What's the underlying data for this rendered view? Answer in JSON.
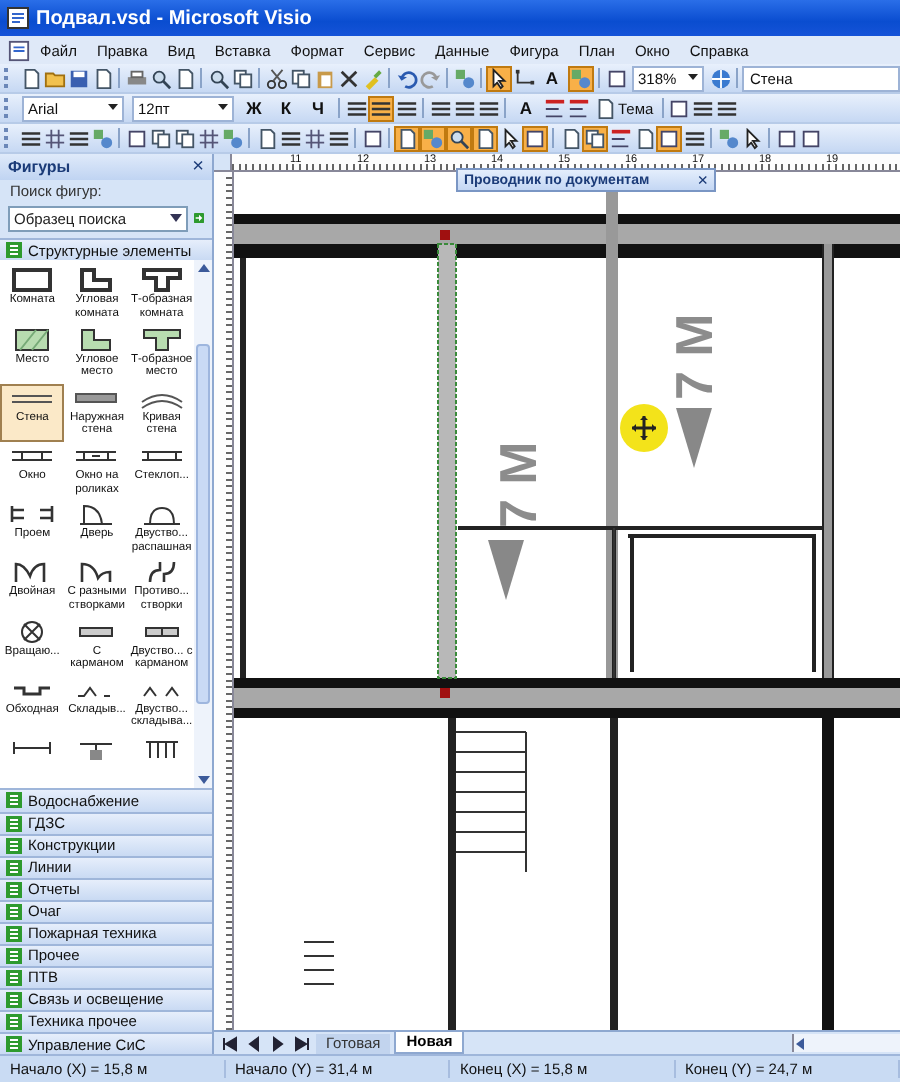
{
  "window": {
    "title": "Подвал.vsd - Microsoft Visio"
  },
  "menu": [
    "Файл",
    "Правка",
    "Вид",
    "Вставка",
    "Формат",
    "Сервис",
    "Данные",
    "Фигура",
    "План",
    "Окно",
    "Справка"
  ],
  "toolbars": [
    {
      "items": [
        {
          "kind": "icon",
          "pressed": false
        },
        {
          "kind": "icon",
          "pressed": false
        },
        {
          "kind": "icon",
          "pressed": false
        },
        {
          "kind": "icon",
          "pressed": false
        },
        {
          "kind": "separator"
        },
        {
          "kind": "icon",
          "pressed": false
        },
        {
          "kind": "icon",
          "pressed": false
        },
        {
          "kind": "icon",
          "pressed": false
        },
        {
          "kind": "separator"
        },
        {
          "kind": "icon",
          "pressed": false
        },
        {
          "kind": "icon",
          "pressed": false
        },
        {
          "kind": "separator"
        },
        {
          "kind": "icon",
          "pressed": false
        },
        {
          "kind": "icon",
          "pressed": false
        },
        {
          "kind": "icon",
          "pressed": false
        },
        {
          "kind": "icon",
          "pressed": false
        },
        {
          "kind": "icon",
          "pressed": false
        },
        {
          "kind": "separator"
        },
        {
          "kind": "icon",
          "pressed": false
        },
        {
          "kind": "icon",
          "pressed": false
        },
        {
          "kind": "separator"
        },
        {
          "kind": "icon",
          "pressed": false
        },
        {
          "kind": "separator"
        },
        {
          "kind": "icon",
          "pressed": true
        },
        {
          "kind": "icon",
          "pressed": false
        },
        {
          "kind": "text",
          "label": "A",
          "pressed": false
        },
        {
          "kind": "icon",
          "pressed": true
        },
        {
          "kind": "separator"
        },
        {
          "kind": "icon",
          "pressed": false
        },
        {
          "kind": "dropdown",
          "value": "318%"
        },
        {
          "kind": "icon",
          "pressed": false
        },
        {
          "kind": "separator"
        },
        {
          "kind": "field",
          "value": "Стена"
        }
      ]
    },
    {
      "items": [
        {
          "kind": "dropdown",
          "value": "Arial"
        },
        {
          "kind": "dropdown",
          "value": "12пт"
        },
        {
          "kind": "text",
          "label": "Ж",
          "pressed": false
        },
        {
          "kind": "text",
          "label": "К",
          "pressed": false
        },
        {
          "kind": "text",
          "label": "Ч",
          "pressed": false
        },
        {
          "kind": "separator"
        },
        {
          "kind": "icon",
          "pressed": false
        },
        {
          "kind": "icon",
          "pressed": true
        },
        {
          "kind": "icon",
          "pressed": false
        },
        {
          "kind": "separator"
        },
        {
          "kind": "icon",
          "pressed": false
        },
        {
          "kind": "icon",
          "pressed": false
        },
        {
          "kind": "icon",
          "pressed": false
        },
        {
          "kind": "separator"
        },
        {
          "kind": "text",
          "label": "A",
          "pressed": false
        },
        {
          "kind": "icon",
          "pressed": false
        },
        {
          "kind": "icon",
          "pressed": false
        },
        {
          "kind": "icon-text",
          "label": "Тема",
          "pressed": false
        },
        {
          "kind": "separator"
        },
        {
          "kind": "icon",
          "pressed": false
        },
        {
          "kind": "icon",
          "pressed": false
        },
        {
          "kind": "icon",
          "pressed": false
        }
      ]
    },
    {
      "items": [
        {
          "kind": "icon",
          "pressed": false
        },
        {
          "kind": "icon",
          "pressed": false
        },
        {
          "kind": "icon",
          "pressed": false
        },
        {
          "kind": "icon",
          "pressed": false
        },
        {
          "kind": "separator"
        },
        {
          "kind": "icon",
          "pressed": false
        },
        {
          "kind": "icon",
          "pressed": false
        },
        {
          "kind": "icon",
          "pressed": false
        },
        {
          "kind": "icon",
          "pressed": false
        },
        {
          "kind": "icon",
          "pressed": false
        },
        {
          "kind": "separator"
        },
        {
          "kind": "icon",
          "pressed": false
        },
        {
          "kind": "icon",
          "pressed": false
        },
        {
          "kind": "icon",
          "pressed": false
        },
        {
          "kind": "icon",
          "pressed": false
        },
        {
          "kind": "separator"
        },
        {
          "kind": "icon",
          "pressed": false
        },
        {
          "kind": "separator"
        },
        {
          "kind": "icon",
          "pressed": true
        },
        {
          "kind": "icon",
          "pressed": true
        },
        {
          "kind": "icon",
          "pressed": true
        },
        {
          "kind": "icon",
          "pressed": true
        },
        {
          "kind": "icon",
          "pressed": false
        },
        {
          "kind": "icon",
          "pressed": true
        },
        {
          "kind": "separator"
        },
        {
          "kind": "icon",
          "pressed": false
        },
        {
          "kind": "icon",
          "pressed": true
        },
        {
          "kind": "icon",
          "pressed": false
        },
        {
          "kind": "icon",
          "pressed": false
        },
        {
          "kind": "icon",
          "pressed": true
        },
        {
          "kind": "icon",
          "pressed": false
        },
        {
          "kind": "separator"
        },
        {
          "kind": "icon",
          "pressed": false
        },
        {
          "kind": "icon",
          "pressed": false
        },
        {
          "kind": "separator"
        },
        {
          "kind": "icon",
          "pressed": false
        },
        {
          "kind": "icon",
          "pressed": false
        }
      ]
    }
  ],
  "shapes_panel": {
    "title": "Фигуры",
    "close": "×",
    "search_label": "Поиск фигур:",
    "search": {
      "placeholder": "Образец поиска"
    },
    "stencil": {
      "title": "Структурные элементы",
      "shapes": [
        {
          "label": "Комната",
          "selected": false
        },
        {
          "label": "Угловая комната",
          "selected": false
        },
        {
          "label": "Т-образная комната",
          "selected": false
        },
        {
          "label": "Место",
          "selected": false
        },
        {
          "label": "Угловое место",
          "selected": false
        },
        {
          "label": "Т-образное место",
          "selected": false
        },
        {
          "label": "Стена",
          "selected": true
        },
        {
          "label": "Наружная стена",
          "selected": false
        },
        {
          "label": "Кривая стена",
          "selected": false
        },
        {
          "label": "Окно",
          "selected": false
        },
        {
          "label": "Окно на роликах",
          "selected": false
        },
        {
          "label": "Стеклоп...",
          "selected": false
        },
        {
          "label": "Проем",
          "selected": false
        },
        {
          "label": "Дверь",
          "selected": false
        },
        {
          "label": "Двуство... распашная",
          "selected": false
        },
        {
          "label": "Двойная",
          "selected": false
        },
        {
          "label": "С разными створками",
          "selected": false
        },
        {
          "label": "Противо... створки",
          "selected": false
        },
        {
          "label": "Вращаю...",
          "selected": false
        },
        {
          "label": "С карманом",
          "selected": false
        },
        {
          "label": "Двуство... с карманом",
          "selected": false
        },
        {
          "label": "Обходная",
          "selected": false
        },
        {
          "label": "Складыв...",
          "selected": false
        },
        {
          "label": "Двуство... складыва...",
          "selected": false
        },
        {
          "selected": false
        },
        {
          "selected": false
        },
        {
          "selected": false
        }
      ]
    },
    "stencils": [
      "Водоснабжение",
      "ГДЗС",
      "Конструкции",
      "Линии",
      "Отчеты",
      "Очаг",
      "Пожарная техника",
      "Прочее",
      "ПТВ",
      "Связь и освещение",
      "Техника прочее",
      "Управление СиС"
    ]
  },
  "ruler": {
    "top_labels": [
      "11",
      "12",
      "13",
      "14",
      "15",
      "16",
      "17",
      "18",
      "19"
    ]
  },
  "drawing": {
    "labels": [
      {
        "text": "7 М"
      },
      {
        "text": "7 М"
      }
    ]
  },
  "document_explorer": {
    "title": "Проводник по документам",
    "close": "×"
  },
  "sheet_tabs": [
    {
      "label": "Готовая",
      "selected": false
    },
    {
      "label": "Новая",
      "selected": true
    }
  ],
  "status_bar": [
    "Начало (X) = 15,8 м",
    "Начало (Y) = 31,4 м",
    "Конец (X) = 15,8 м",
    "Конец (Y) = 24,7 м"
  ]
}
